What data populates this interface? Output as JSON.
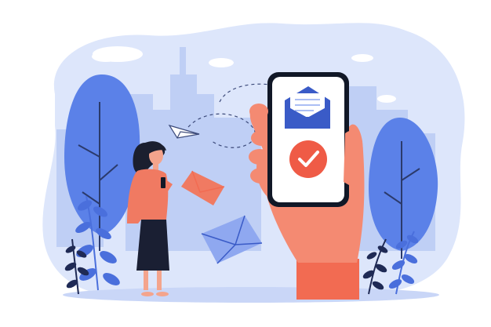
{
  "illustration": {
    "subject": "email-notification-on-phone",
    "colors": {
      "background": "#ffffff",
      "blob": "#dde6fb",
      "city": "#bfcff5",
      "tree": "#5b81e8",
      "tree_trunk": "#2b3a6b",
      "plant_blue": "#4a6fdc",
      "plant_dark": "#1f2a55",
      "ground": "#c9d6f7",
      "phone_body": "#111827",
      "phone_screen": "#ffffff",
      "envelope_blue": "#3a5bc7",
      "envelope_light": "#8fa8f0",
      "envelope_red": "#f07a62",
      "check_red": "#ef5b46",
      "hand": "#f48a72",
      "sleeve": "#f26b52",
      "woman_top": "#f07a62",
      "woman_skirt": "#1a1f33",
      "woman_hair": "#1b1f2f",
      "skin": "#f4a48c",
      "cloud": "#ffffff",
      "dash": "#3c4a7a"
    },
    "icons": [
      "paper-plane-icon",
      "envelope-icon",
      "check-circle-icon",
      "open-letter-icon"
    ]
  }
}
